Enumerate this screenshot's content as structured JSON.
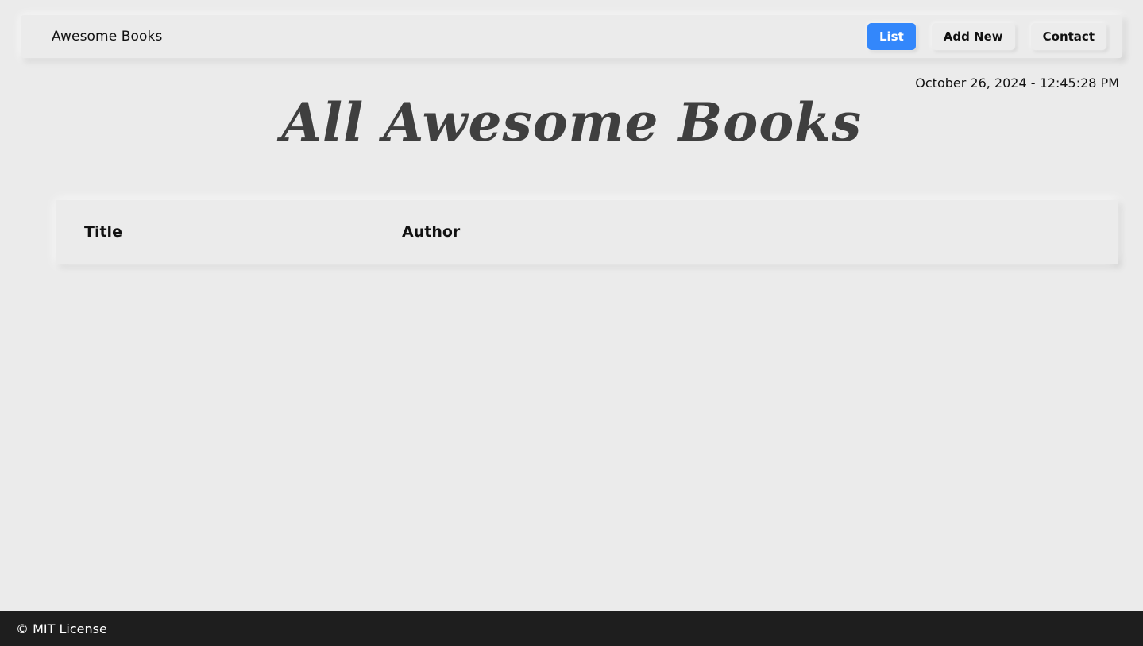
{
  "navbar": {
    "brand": "Awesome Books",
    "links": [
      {
        "label": "List",
        "active": true
      },
      {
        "label": "Add New",
        "active": false
      },
      {
        "label": "Contact",
        "active": false
      }
    ]
  },
  "datetime": "October 26, 2024 - 12:45:28 PM",
  "heading": "All Awesome Books",
  "table": {
    "headers": [
      "Title",
      "Author"
    ]
  },
  "footer": {
    "text": "© MIT License"
  },
  "colors": {
    "background": "#ebebeb",
    "accent": "#3387fb",
    "footer": "#1e1e1e",
    "heading": "#3f3f3f"
  }
}
